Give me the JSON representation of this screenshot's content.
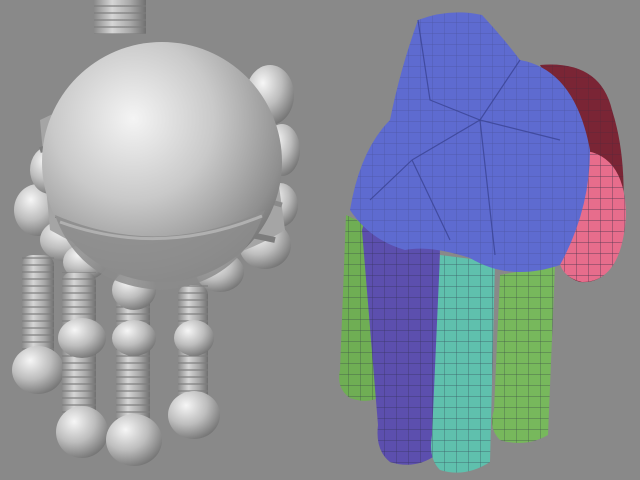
{
  "viewport": {
    "background": "#898989"
  },
  "left_model": {
    "kind": "sphere-primitive hand mesh",
    "color": "#b4b4b4"
  },
  "right_model": {
    "kind": "polygroup-colored hand mesh",
    "colors": {
      "palm": "#5e6bd0",
      "index_finger": "#5c4fae",
      "thumb_side_finger": "#6fae54",
      "middle_finger": "#5fc0ad",
      "ring_finger": "#77b85c",
      "thumb_upper": "#7a2535",
      "thumb_lower": "#e76d8c"
    }
  }
}
